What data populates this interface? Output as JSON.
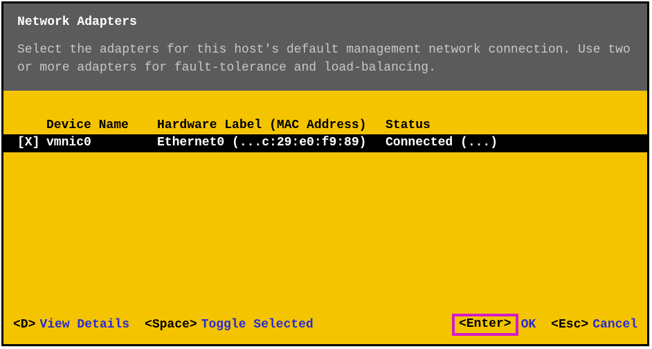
{
  "header": {
    "title": "Network Adapters",
    "subtitle": "Select the adapters for this host's default management network connection. Use two or more adapters for fault-tolerance and load-balancing."
  },
  "table": {
    "headers": {
      "device": "Device Name",
      "hw": "Hardware Label (MAC Address)",
      "status": "Status"
    },
    "rows": [
      {
        "checked": "[X]",
        "device": "vmnic0",
        "hw": "Ethernet0 (...c:29:e0:f9:89)",
        "status": "Connected (...)"
      }
    ]
  },
  "footer": {
    "d_key": "<D>",
    "d_action": "View Details",
    "space_key": "<Space>",
    "space_action": "Toggle Selected",
    "enter_key": "<Enter>",
    "enter_action": "OK",
    "esc_key": "<Esc>",
    "esc_action": "Cancel"
  }
}
